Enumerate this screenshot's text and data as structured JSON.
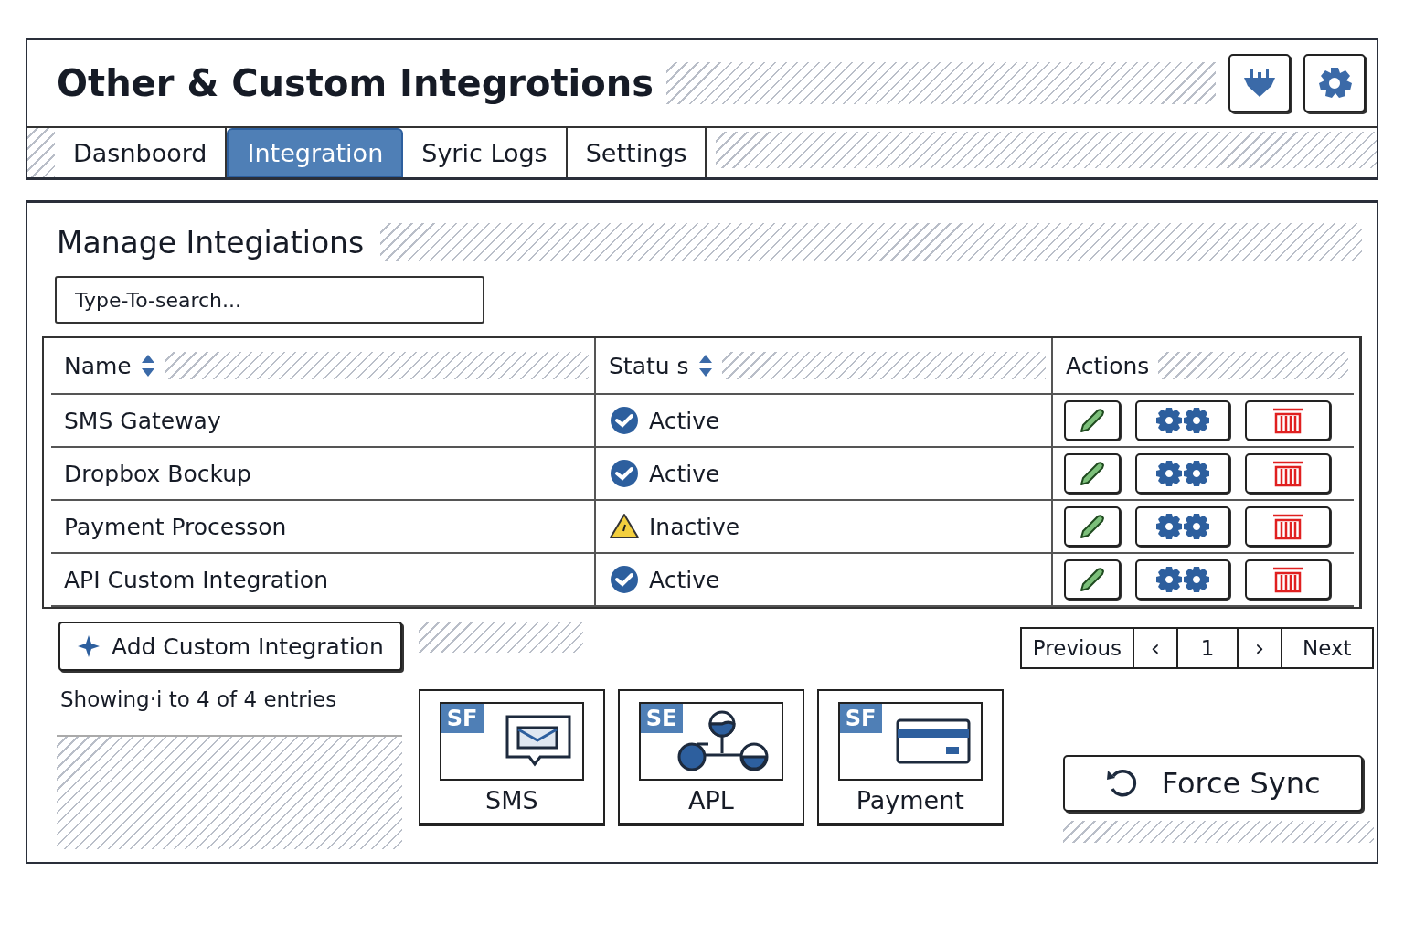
{
  "window": {
    "title": "Other & Custom Integrotions"
  },
  "tabs": [
    {
      "label": "Dasnboord",
      "selected": false
    },
    {
      "label": "Integration",
      "selected": true
    },
    {
      "label": "Syric Logs",
      "selected": false
    },
    {
      "label": "Settings",
      "selected": false
    }
  ],
  "panel": {
    "title": "Manage Integiations"
  },
  "search": {
    "placeholder": "Type-To-search..."
  },
  "table": {
    "columns": [
      "Name",
      "Statu s",
      "Actions"
    ],
    "rows": [
      {
        "name": "SMS Gateway",
        "status": {
          "text": "Active",
          "kind": "ok"
        }
      },
      {
        "name": "Dropbox Bockup",
        "status": {
          "text": "Active",
          "kind": "ok"
        }
      },
      {
        "name": "Payment Processon",
        "status": {
          "text": "Inactive",
          "kind": "warning"
        }
      },
      {
        "name": "API Custom Integration",
        "status": {
          "text": "Active",
          "kind": "ok"
        }
      }
    ]
  },
  "add_button": "Add Custom Integration",
  "entries_info": "Showing·i to 4 of 4 entries",
  "pagination": {
    "previous": "Previous",
    "prev_arrow": "‹",
    "pages": [
      {
        "label": "1",
        "selected": false
      }
    ],
    "next_arrow": "›",
    "next": "Next"
  },
  "cards": [
    {
      "badge": "SF",
      "label": "SMS",
      "kind": "sms"
    },
    {
      "badge": "SE",
      "label": "APL",
      "kind": "api"
    },
    {
      "badge": "SF",
      "label": "Payment",
      "kind": "payment"
    }
  ],
  "force_sync": "Force Sync"
}
